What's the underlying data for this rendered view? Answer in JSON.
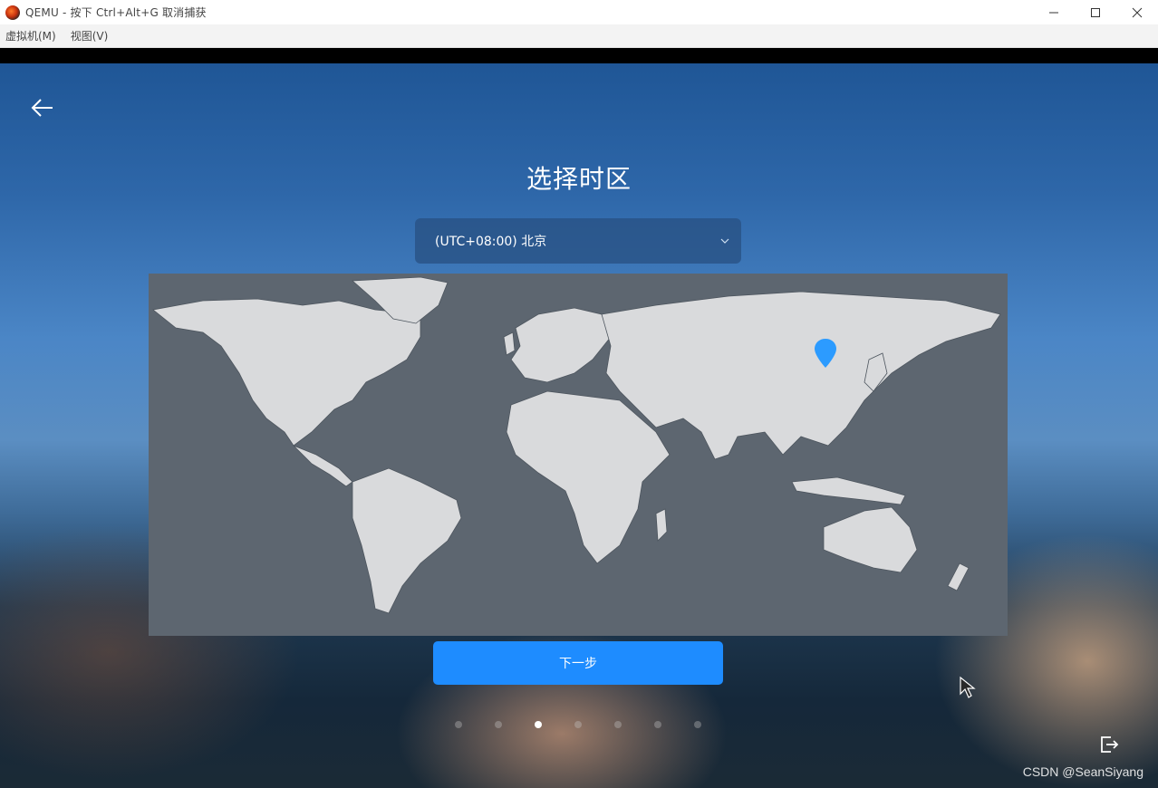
{
  "window": {
    "title": "QEMU - 按下 Ctrl+Alt+G 取消捕获",
    "controls": {
      "minimize": "—",
      "maximize": "☐",
      "close": "✕"
    }
  },
  "menubar": {
    "items": [
      {
        "label": "虚拟机(M)"
      },
      {
        "label": "视图(V)"
      }
    ]
  },
  "installer": {
    "title": "选择时区",
    "timezone": {
      "value": "(UTC+08:00) 北京"
    },
    "next_label": "下一步",
    "steps": {
      "total": 7,
      "current": 3
    }
  },
  "watermark": "CSDN @SeanSiyang",
  "colors": {
    "accent": "#1e8cff",
    "map_bg": "#5d6670",
    "land": "#d9dadc",
    "pin": "#2c9bff"
  },
  "icons": [
    "back-arrow-icon",
    "chevron-down-icon",
    "map-pin-icon",
    "exit-icon",
    "mouse-cursor-icon",
    "qemu-logo-icon"
  ]
}
